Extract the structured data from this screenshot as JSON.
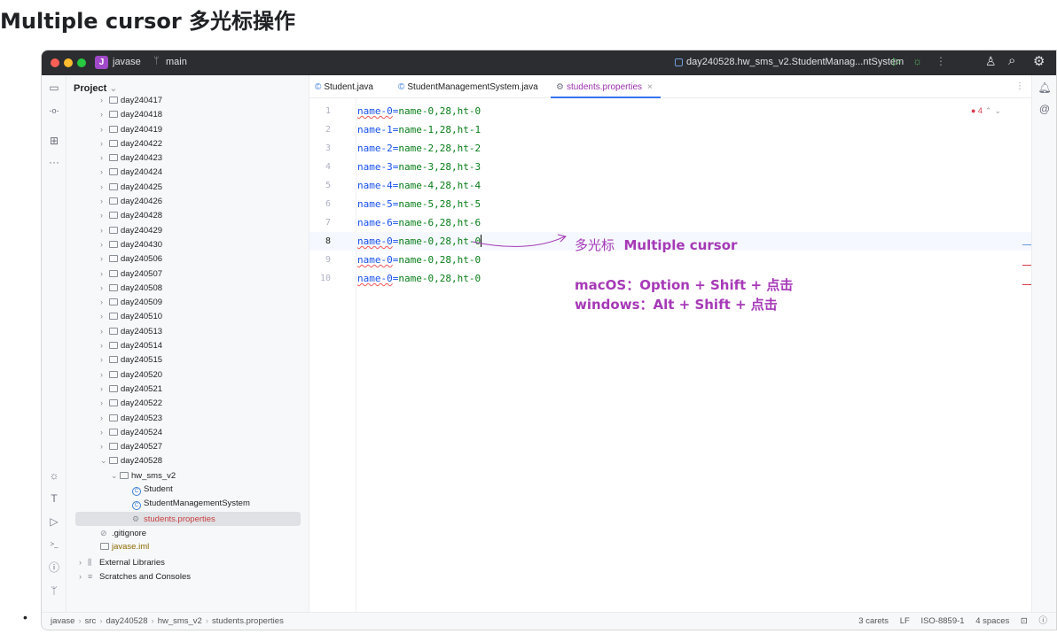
{
  "page": {
    "heading": "Multiple cursor 多光标操作",
    "bullet": "•"
  },
  "titlebar": {
    "project_badge": "J",
    "project_name": "javase",
    "branch_name": "main",
    "run_config": "day240528.hw_sms_v2.StudentManag...ntSystem",
    "run_icon": "▷",
    "debug_icon": "☼",
    "more_icon": "⋮",
    "user_icon": "♙",
    "search_icon": "⌕",
    "settings_icon": "⚙"
  },
  "toolstrip": {
    "folder_icon": "▭",
    "commit_icon": "-o-",
    "structure_icon": "⊞",
    "more_icon": "···",
    "debug_icon": "☼",
    "build_icon": "T",
    "services_icon": "▷",
    "terminal_icon": ">_",
    "problems_icon": "ⓘ",
    "git_icon": "ᛘ"
  },
  "project": {
    "title": "Project",
    "chevron": "⌄",
    "folders": [
      "day240417",
      "day240418",
      "day240419",
      "day240422",
      "day240423",
      "day240424",
      "day240425",
      "day240426",
      "day240428",
      "day240429",
      "day240430",
      "day240506",
      "day240507",
      "day240508",
      "day240509",
      "day240510",
      "day240513",
      "day240514",
      "day240515",
      "day240520",
      "day240521",
      "day240522",
      "day240523",
      "day240524",
      "day240527"
    ],
    "open_folder": "day240528",
    "subfolder": "hw_sms_v2",
    "class1": "Student",
    "class2": "StudentManagementSystem",
    "properties_file": "students.properties",
    "gitignore": ".gitignore",
    "iml": "javase.iml",
    "ext_libs": "External Libraries",
    "scratches": "Scratches and Consoles"
  },
  "tabs": {
    "tab1": "Student.java",
    "tab2": "StudentManagementSystem.java",
    "tab3": "students.properties",
    "close": "×",
    "menu": "⋮"
  },
  "editor": {
    "error_count": "4",
    "lines": [
      {
        "n": "1",
        "key": "name-0",
        "val": "name-0,28,ht-0"
      },
      {
        "n": "2",
        "key": "name-1",
        "val": "name-1,28,ht-1"
      },
      {
        "n": "3",
        "key": "name-2",
        "val": "name-2,28,ht-2"
      },
      {
        "n": "4",
        "key": "name-3",
        "val": "name-3,28,ht-3"
      },
      {
        "n": "5",
        "key": "name-4",
        "val": "name-4,28,ht-4"
      },
      {
        "n": "6",
        "key": "name-5",
        "val": "name-5,28,ht-5"
      },
      {
        "n": "7",
        "key": "name-6",
        "val": "name-6,28,ht-6"
      },
      {
        "n": "8",
        "key": "name-0",
        "val": "name-0,28,ht-0"
      },
      {
        "n": "9",
        "key": "name-0",
        "val": "name-0,28,ht-0"
      },
      {
        "n": "10",
        "key": "name-0",
        "val": "name-0,28,ht-0"
      }
    ]
  },
  "annotations": {
    "multi_zh": "多光标",
    "multi_en": "Multiple cursor",
    "mac": "macOS：Option + Shift + 点击",
    "windows": "windows：Alt + Shift + 点击"
  },
  "statusbar": {
    "crumb1": "javase",
    "crumb2": "src",
    "crumb3": "day240528",
    "crumb4": "hw_sms_v2",
    "crumb5": "students.properties",
    "carets": "3 carets",
    "line_sep": "LF",
    "encoding": "ISO-8859-1",
    "indent": "4 spaces"
  },
  "colors": {
    "accent": "#3574f0",
    "annotation": "#a639b7",
    "error": "#db3b4b"
  }
}
